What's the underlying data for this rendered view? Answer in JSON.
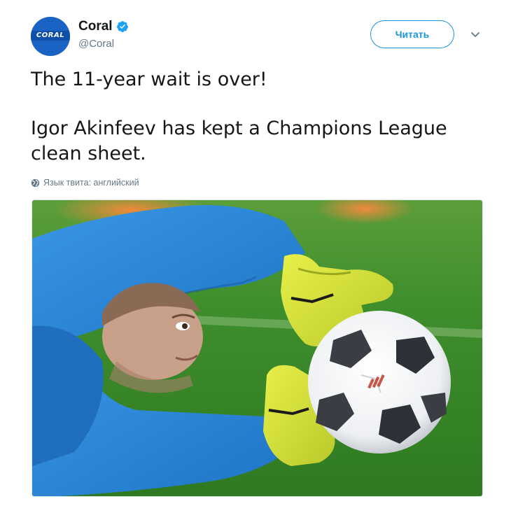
{
  "tweet": {
    "author": {
      "name": "Coral",
      "handle": "@Coral",
      "avatar_logo_text": "CORAL",
      "verified_icon": "verified-badge-icon"
    },
    "follow_label": "Читать",
    "menu_icon": "chevron-down-icon",
    "text_line1": "The 11-year wait is over!",
    "text_line2": "Igor Akinfeev has kept a Champions League clean sheet.",
    "language_note": "Язык твита: английский",
    "language_icon": "globe-icon",
    "media": {
      "alt": "Goalkeeper in blue kit and yellow gloves diving to catch a football on grass"
    }
  },
  "colors": {
    "accent": "#1b95e0",
    "avatar_blue": "#1a63c4",
    "text_primary": "#14171a",
    "text_secondary": "#657786",
    "kit_blue": "#2a86d8",
    "glove_yellow": "#d8e83a",
    "grass_green": "#3f8e2c"
  }
}
